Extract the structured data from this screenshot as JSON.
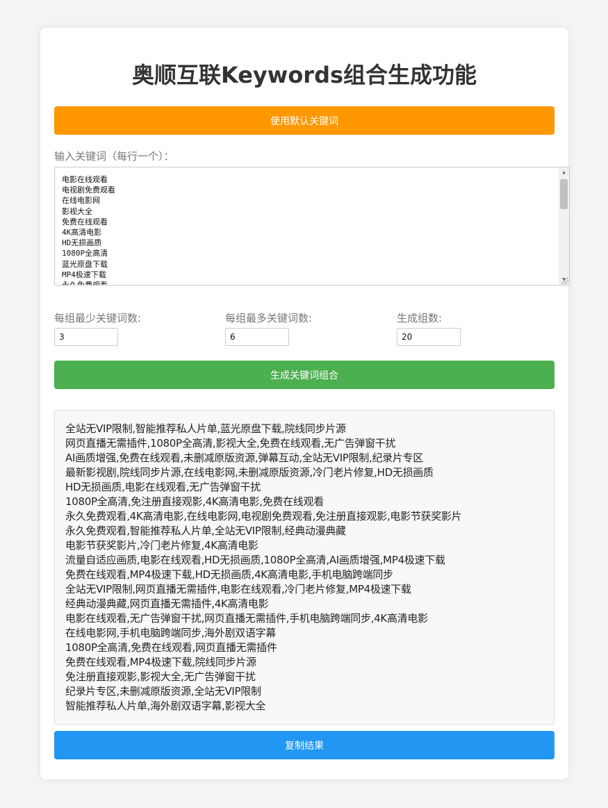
{
  "page": {
    "title": "奥顺互联Keywords组合生成功能"
  },
  "buttons": {
    "use_default": "使用默认关键词",
    "generate": "生成关键词组合",
    "copy": "复制结果"
  },
  "keywords_input": {
    "label": "输入关键词（每行一个）：",
    "lines": [
      "电影在线观看",
      "电视剧免费观看",
      "在线电影网",
      "影视大全",
      "免费在线观看",
      "4K高清电影",
      "HD无损画质",
      "1080P全高清",
      "蓝光原盘下载",
      "MP4极速下载",
      "永久免费观看"
    ]
  },
  "settings": {
    "min_label": "每组最少关键词数:",
    "min_value": "3",
    "max_label": "每组最多关键词数:",
    "max_value": "6",
    "groups_label": "生成组数:",
    "groups_value": "20"
  },
  "results": [
    "全站无VIP限制,智能推荐私人片单,蓝光原盘下载,院线同步片源",
    "网页直播无需插件,1080P全高清,影视大全,免费在线观看,无广告弹窗干扰",
    "AI画质增强,免费在线观看,未删减原版资源,弹幕互动,全站无VIP限制,纪录片专区",
    "最新影视剧,院线同步片源,在线电影网,未删减原版资源,冷门老片修复,HD无损画质",
    "HD无损画质,电影在线观看,无广告弹窗干扰",
    "1080P全高清,免注册直接观影,4K高清电影,免费在线观看",
    "永久免费观看,4K高清电影,在线电影网,电视剧免费观看,免注册直接观影,电影节获奖影片",
    "永久免费观看,智能推荐私人片单,全站无VIP限制,经典动漫典藏",
    "电影节获奖影片,冷门老片修复,4K高清电影",
    "流量自适应画质,电影在线观看,HD无损画质,1080P全高清,AI画质增强,MP4极速下载",
    "免费在线观看,MP4极速下载,HD无损画质,4K高清电影,手机电脑跨端同步",
    "全站无VIP限制,网页直播无需插件,电影在线观看,冷门老片修复,MP4极速下载",
    "经典动漫典藏,网页直播无需插件,4K高清电影",
    "电影在线观看,无广告弹窗干扰,网页直播无需插件,手机电脑跨端同步,4K高清电影",
    "在线电影网,手机电脑跨端同步,海外剧双语字幕",
    "1080P全高清,免费在线观看,网页直播无需插件",
    "免费在线观看,MP4极速下载,院线同步片源",
    "免注册直接观影,影视大全,无广告弹窗干扰",
    "纪录片专区,未删减原版资源,全站无VIP限制",
    "智能推荐私人片单,海外剧双语字幕,影视大全"
  ],
  "colors": {
    "default_button": "#ff9800",
    "generate_button": "#4caf50",
    "copy_button": "#2196f3"
  }
}
